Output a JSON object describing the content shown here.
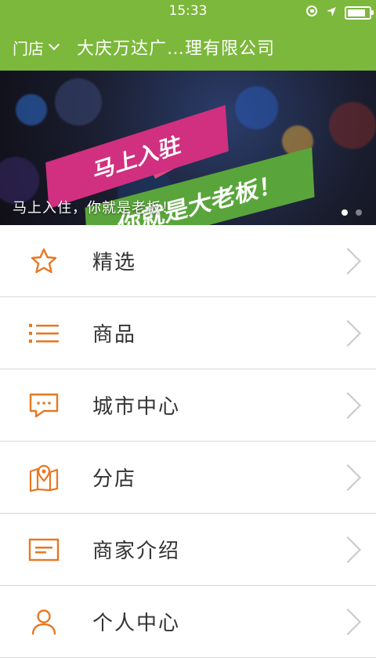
{
  "status_bar": {
    "carrier": "",
    "time": "15:33"
  },
  "navbar": {
    "store_label": "门店",
    "company_name": "大庆万达广…理有限公司"
  },
  "banner": {
    "headline_1": "马上入驻",
    "headline_2": "你就是大老板！",
    "caption": "马上入住，你就是老板！"
  },
  "menu": {
    "items": [
      {
        "label": "精选",
        "icon": "star-icon"
      },
      {
        "label": "商品",
        "icon": "list-icon"
      },
      {
        "label": "城市中心",
        "icon": "chat-icon"
      },
      {
        "label": "分店",
        "icon": "map-icon"
      },
      {
        "label": "商家介绍",
        "icon": "card-icon"
      },
      {
        "label": "个人中心",
        "icon": "user-icon"
      }
    ]
  },
  "colors": {
    "brand_green": "#7cb83b",
    "icon_orange": "#e87722"
  }
}
